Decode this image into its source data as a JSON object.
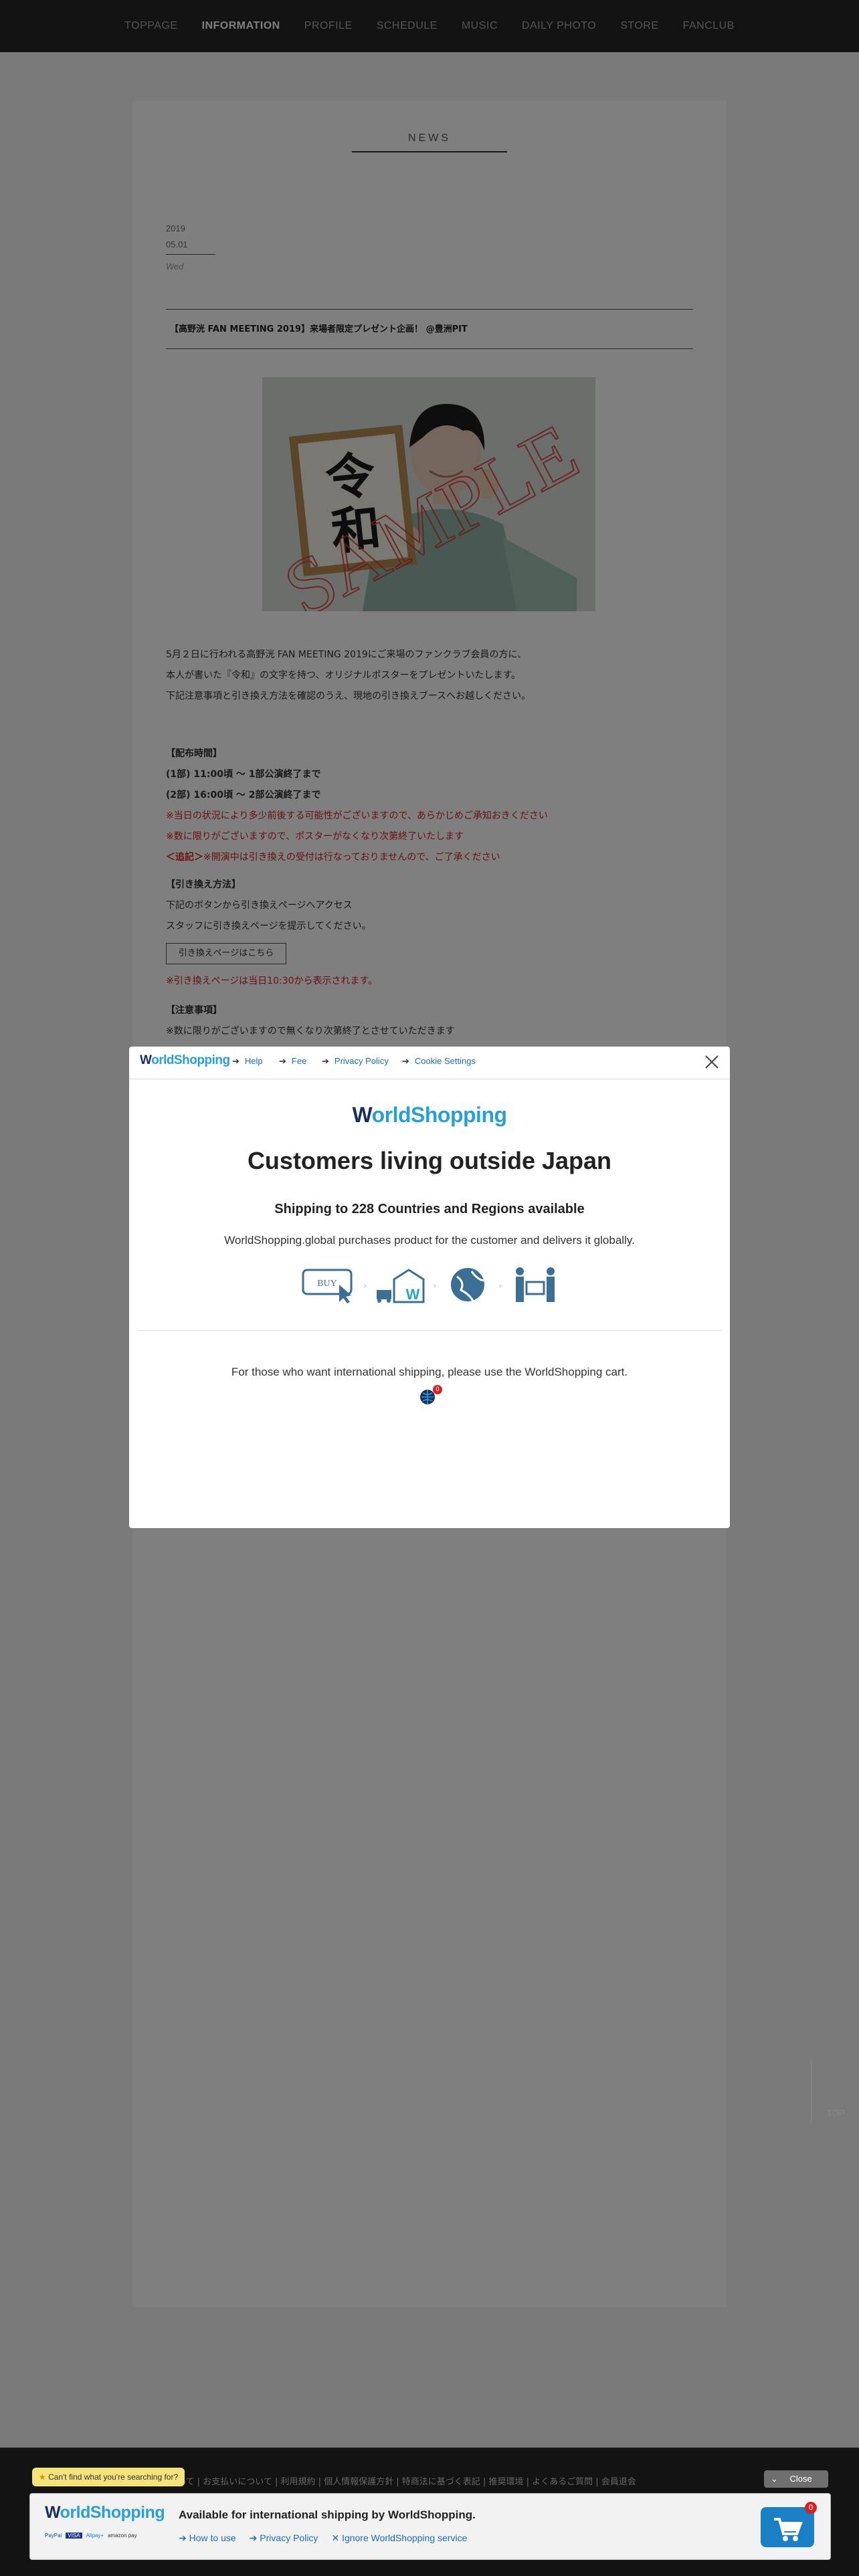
{
  "nav": {
    "items": [
      "TOPPAGE",
      "INFORMATION",
      "PROFILE",
      "SCHEDULE",
      "MUSIC",
      "DAILY PHOTO",
      "STORE",
      "FANCLUB"
    ],
    "active_index": 1
  },
  "article": {
    "section_title": "NEWS",
    "date_year": "2019",
    "date_day": "05.01",
    "date_weekday": "Wed",
    "title": "【高野洸 FAN MEETING 2019】来場者限定プレゼント企画！ @豊洲PIT",
    "photo_watermark": "SAMPLE",
    "photo_calligraphy": "令和",
    "intro_lines": [
      "5月２日に行われる高野洸 FAN MEETING 2019にご来場のファンクラブ会員の方に、",
      "本人が書いた『令和』の文字を持つ、オリジナルポスターをプレゼントいたします。",
      "下記注意事項と引き換え方法を確認のうえ、現地の引き換えブースへお越しください。"
    ],
    "schedule_heading": "【配布時間】",
    "schedule_lines": [
      "(1部) 11:00頃 〜 1部公演終了まで",
      "(2部) 16:00頃 〜 2部公演終了まで"
    ],
    "schedule_notes": [
      "※当日の状況により多少前後する可能性がございますので、あらかじめご承知おきください",
      "※数に限りがございますので、ポスターがなくなり次第終了いたします"
    ],
    "schedule_notice_prefix": "＜追記＞",
    "schedule_notice": "※開演中は引き換えの受付は行なっておりませんので、ご了承ください",
    "exchange_heading": "【引き換え方法】",
    "exchange_lines": [
      "下記のボタンから引き換えページへアクセス",
      "スタッフに引き換えページを提示してください。"
    ],
    "exchange_button": "引き換えページはこちら",
    "exchange_note": "※引き換えページは当日10:30から表示されます。",
    "caution_heading": "【注意事項】",
    "caution_lines": [
      "※数に限りがございますので無くなり次第終了とさせていただきます"
    ]
  },
  "modal": {
    "logo_w": "W",
    "logo_rest": "orldShopping",
    "links": [
      "Help",
      "Fee",
      "Privacy Policy",
      "Cookie Settings"
    ],
    "title": "Customers living outside Japan",
    "subtitle": "Shipping to 228 Countries and Regions available",
    "description": "WorldShopping.global purchases product for the customer and delivers it globally.",
    "step_buy_label": "BUY",
    "note": "For those who want international shipping, please use the WorldShopping cart.",
    "cart_badge": "0",
    "colors": {
      "brand_dark": "#1b2f5e",
      "brand_light": "#2a9fd6"
    }
  },
  "page_footer": {
    "links": "サイトについて | お支払いについて | 利用規約 | 個人情報保護方針 | 特商法に基づく表記 | 推奨環境 | よくあるご質問 | 会員退会"
  },
  "top_button": "TOP",
  "ws_bar": {
    "tooltip": "Can't find what you're searching for?",
    "close_label": "Close",
    "headline": "Available for international shipping by WorldShopping.",
    "links": [
      "How to use",
      "Privacy Policy",
      "Ignore WorldShopping service"
    ],
    "payment_labels": [
      "PayPal",
      "VISA",
      "Alipay+",
      "amazon pay"
    ],
    "cart_badge": "0"
  }
}
